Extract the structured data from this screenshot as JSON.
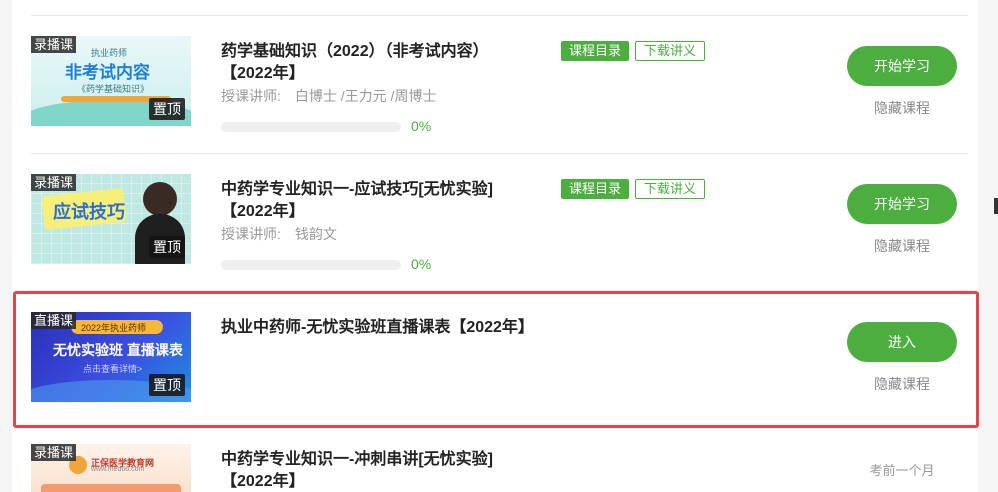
{
  "courses": [
    {
      "kind": "录播课",
      "pin": "置顶",
      "thumb_top": "执业药师",
      "thumb_main": "非考试内容",
      "thumb_sub": "《药学基础知识》",
      "title_line1": "药学基础知识（2022）（非考试内容）",
      "title_line2": "【2022年】",
      "teacher_label": "授课讲师:",
      "teacher_names": "白博士 /王力元 /周博士",
      "progress_percent": 0,
      "progress_text": "0%",
      "tag_catalog": "课程目录",
      "tag_download": "下载讲义",
      "action": "开始学习",
      "hide": "隐藏课程"
    },
    {
      "kind": "录播课",
      "pin": "置顶",
      "thumb_main": "应试技巧",
      "title_line1": "中药学专业知识一-应试技巧[无忧实验]",
      "title_line2": "【2022年】",
      "teacher_label": "授课讲师:",
      "teacher_names": "钱韵文",
      "progress_percent": 0,
      "progress_text": "0%",
      "tag_catalog": "课程目录",
      "tag_download": "下载讲义",
      "action": "开始学习",
      "hide": "隐藏课程"
    },
    {
      "kind": "直播课",
      "pin": "置顶",
      "thumb_top": "2022年执业药师",
      "thumb_main": "无忧实验班 直播课表",
      "thumb_sub": "点击查看详情>",
      "title_line1": "执业中药师-无忧实验班直播课表【2022年】",
      "action": "进入",
      "hide": "隐藏课程"
    },
    {
      "kind": "录播课",
      "thumb_brand": "正保医学教育网",
      "thumb_site": "www.med66.com",
      "title_line1": "中药学专业知识一-冲刺串讲[无忧实验]",
      "title_line2": "【2022年】",
      "exam_time": "考前一个月"
    }
  ],
  "colors": {
    "accent": "#4cae3f",
    "highlight": "#e0464a"
  }
}
